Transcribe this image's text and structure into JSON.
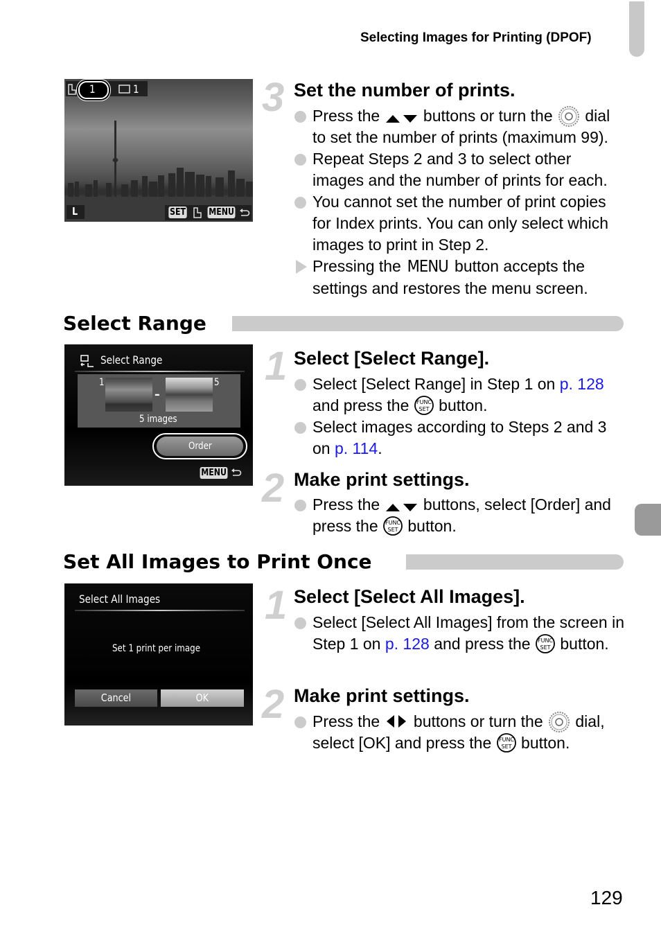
{
  "header": {
    "running_title": "Selecting Images for Printing (DPOF)"
  },
  "page_number": "129",
  "step3": {
    "number": "3",
    "title": "Set the number of prints.",
    "bullets": [
      {
        "type": "dot",
        "parts": [
          "Press the ",
          "up-down-arrows-icon",
          " buttons or turn the ",
          "control-dial-icon",
          " dial to set the number of prints (maximum 99)."
        ]
      },
      {
        "type": "dot",
        "text": "Repeat Steps 2 and 3 to select other images and the number of prints for each."
      },
      {
        "type": "dot",
        "text": "You cannot set the number of print copies for Index prints. You can only select which images to print in Step 2."
      },
      {
        "type": "arrow",
        "before": "Pressing the ",
        "menu_word": "MENU",
        "after": " button accepts the settings and restores the menu screen."
      }
    ],
    "screen": {
      "print_count": "1",
      "image_count": "1",
      "size_label": "L",
      "set_label": "SET",
      "menu_label": "MENU"
    }
  },
  "select_range": {
    "section_title": "Select Range",
    "screen": {
      "title": "Select Range",
      "range_start": "1",
      "range_end": "5",
      "dash": "–",
      "count_label": "5 images",
      "order_button": "Order",
      "menu_label": "MENU"
    },
    "step1": {
      "number": "1",
      "title": "Select [Select Range].",
      "b1_pre": "Select [Select Range] in Step 1 on ",
      "b1_link": "p. 128",
      "b1_mid": " and press the ",
      "b1_post": " button.",
      "b2_pre": "Select images according to Steps 2 and 3 on ",
      "b2_link": "p. 114",
      "b2_post": "."
    },
    "step2": {
      "number": "2",
      "title": "Make print settings.",
      "b1_pre": "Press the ",
      "b1_mid": " buttons, select [Order] and press the ",
      "b1_post": " button."
    }
  },
  "all_images": {
    "section_title": "Set All Images to Print Once",
    "screen": {
      "title": "Select All Images",
      "message": "Set 1 print per image",
      "cancel_button": "Cancel",
      "ok_button": "OK"
    },
    "step1": {
      "number": "1",
      "title": "Select [Select All Images].",
      "b1_pre": "Select [Select All Images] from the screen in Step 1 on ",
      "b1_link": "p. 128",
      "b1_mid": " and press the ",
      "b1_post": " button."
    },
    "step2": {
      "number": "2",
      "title": "Make print settings.",
      "b1_pre": "Press the ",
      "b1_mid1": " buttons or turn the ",
      "b1_mid2": " dial, select [OK] and press the ",
      "b1_post": " button."
    }
  },
  "colors": {
    "link": "#1a1ae6",
    "step_number": "#cfcfcf",
    "section_bar": "#cbcbcb",
    "thumb_tab": "#9a9a9a"
  }
}
